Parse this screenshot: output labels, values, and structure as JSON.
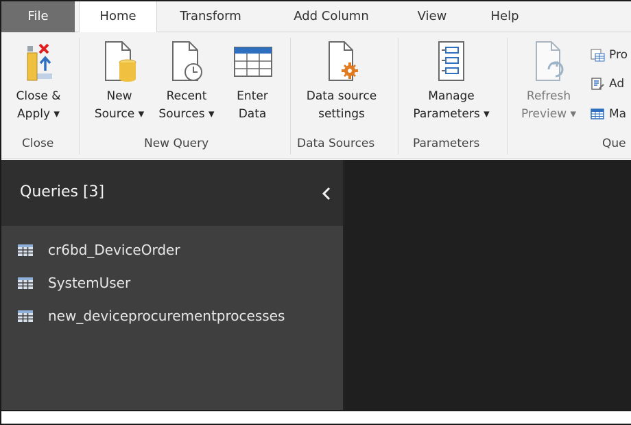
{
  "tabs": {
    "file": "File",
    "home": "Home",
    "transform": "Transform",
    "add_column": "Add Column",
    "view": "View",
    "help": "Help"
  },
  "ribbon": {
    "close_apply": {
      "line1": "Close &",
      "line2": "Apply ▾"
    },
    "close_group": "Close",
    "new_source": {
      "line1": "New",
      "line2": "Source ▾"
    },
    "recent_sources": {
      "line1": "Recent",
      "line2": "Sources ▾"
    },
    "enter_data": {
      "line1": "Enter",
      "line2": "Data"
    },
    "new_query_group": "New Query",
    "data_source_settings": {
      "line1": "Data source",
      "line2": "settings"
    },
    "data_sources_group": "Data Sources",
    "manage_parameters": {
      "line1": "Manage",
      "line2": "Parameters ▾"
    },
    "parameters_group": "Parameters",
    "refresh_preview": {
      "line1": "Refresh",
      "line2": "Preview ▾"
    },
    "properties": "Pro",
    "advanced_editor": "Ad",
    "manage": "Ma",
    "query_group": "Que"
  },
  "queries": {
    "title": "Queries [3]",
    "items": [
      {
        "label": "cr6bd_DeviceOrder"
      },
      {
        "label": "SystemUser"
      },
      {
        "label": "new_deviceprocurementprocesses"
      }
    ]
  },
  "colors": {
    "accent_blue": "#2f6fbf",
    "gear_orange": "#e07b1f",
    "cylinder_yellow": "#f0c040",
    "close_red": "#e02020"
  }
}
